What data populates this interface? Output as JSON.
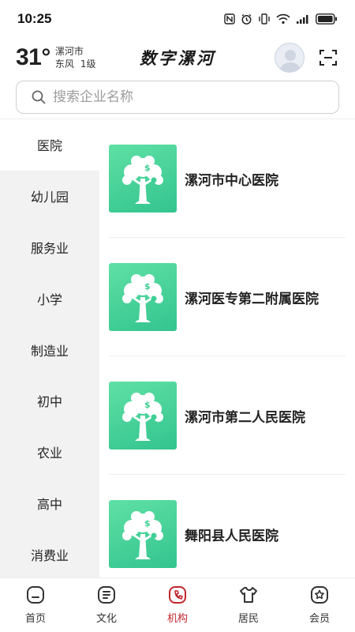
{
  "status_bar": {
    "time": "10:25",
    "battery_level": 0.85
  },
  "header": {
    "temperature": "31°",
    "city": "漯河市",
    "wind": "东风",
    "wind_level": "1级",
    "app_title": "数字漯河"
  },
  "search": {
    "placeholder": "搜索企业名称",
    "value": ""
  },
  "categories": [
    {
      "label": "医院",
      "active": true
    },
    {
      "label": "幼儿园"
    },
    {
      "label": "服务业"
    },
    {
      "label": "小学"
    },
    {
      "label": "制造业"
    },
    {
      "label": "初中"
    },
    {
      "label": "农业"
    },
    {
      "label": "高中"
    },
    {
      "label": "消费业"
    }
  ],
  "institutions": [
    {
      "name": "漯河市中心医院"
    },
    {
      "name": "漯河医专第二附属医院"
    },
    {
      "name": "漯河市第二人民医院"
    },
    {
      "name": "舞阳县人民医院"
    }
  ],
  "tabs": [
    {
      "label": "首页",
      "icon": "home-icon"
    },
    {
      "label": "文化",
      "icon": "culture-icon"
    },
    {
      "label": "机构",
      "icon": "institution-icon",
      "active": true
    },
    {
      "label": "居民",
      "icon": "resident-icon"
    },
    {
      "label": "会员",
      "icon": "member-icon"
    }
  ],
  "colors": {
    "accent": "#c0272d",
    "thumbnail_green": "#3fcf94",
    "sidebar_bg": "#f2f2f2"
  }
}
